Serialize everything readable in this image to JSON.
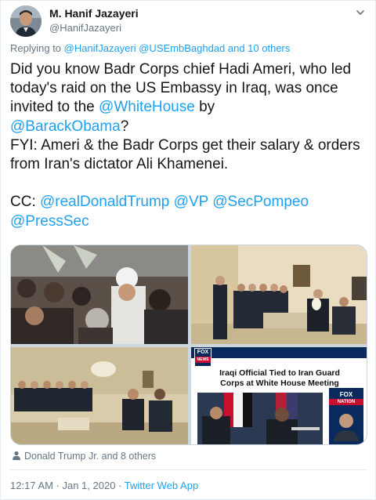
{
  "author": {
    "display_name": "M. Hanif Jazayeri",
    "handle": "@HanifJazayeri",
    "avatar_icon": "avatar-photo"
  },
  "menu": {
    "icon": "chevron-down-icon"
  },
  "reply_context": {
    "prefix": "Replying to",
    "mentions": "@HanifJazayeri @USEmbBaghdad and 10 others"
  },
  "tweet": {
    "p1_a": "Did you know Badr Corps chief Hadi Ameri, who led today's raid on the US Embassy in Iraq, was once invited to the ",
    "p1_link1": "@WhiteHouse",
    "p1_b": " by ",
    "p1_link2": "@BarackObama",
    "p1_c": "?",
    "p2": "FYI: Ameri & the Badr Corps get their salary & orders from Iran's dictator Ali Khamenei.",
    "cc_label": "CC: ",
    "cc_mentions": [
      "@realDonaldTrump",
      "@VP",
      "@SecPompeo",
      "@PressSec"
    ]
  },
  "media": {
    "screenshot": {
      "logo_top": "FOX",
      "logo_bottom": "NEWS",
      "headline_1": "Iraqi Official Tied to Iran Guard",
      "headline_2": "Corps at White House Meeting",
      "ad_top": "FOX",
      "ad_bottom": "NATION"
    }
  },
  "social": {
    "liked_by": "Donald Trump Jr. and 8 others"
  },
  "meta": {
    "timestamp": "12:17 AM · Jan 1, 2020",
    "separator": " · ",
    "source": "Twitter Web App"
  },
  "colors": {
    "link": "#1da1f2",
    "secondary_text": "#657786",
    "primary_text": "#14171a",
    "fox_red": "#c8102e",
    "fox_navy": "#0a2a5e"
  }
}
